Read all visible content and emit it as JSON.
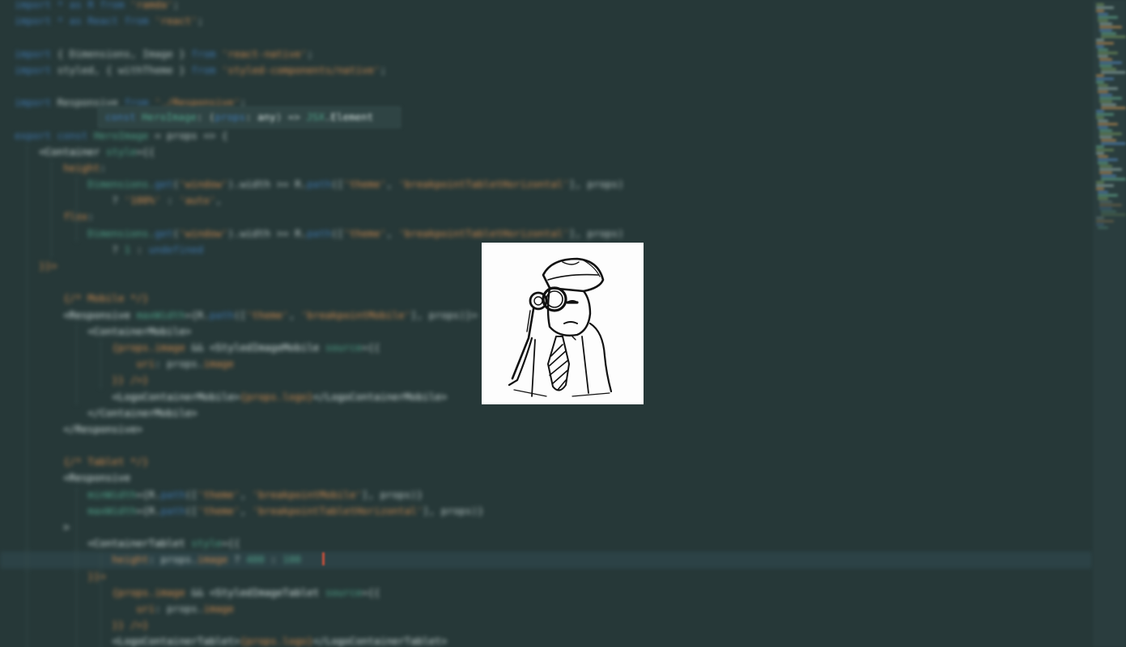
{
  "theme": {
    "background": "#263838",
    "keyword": "#3f78b0",
    "string": "#d18b4f",
    "identifier": "#b9c6c4",
    "type": "#52a58c",
    "bright": "#d6e2e0"
  },
  "editor": {
    "lines": [
      [
        {
          "t": "import ",
          "c": "kw"
        },
        {
          "t": "* as R from ",
          "c": "kw"
        },
        {
          "t": "'ramda'",
          "c": "str"
        },
        {
          "t": ";",
          "c": "pl"
        }
      ],
      [
        {
          "t": "import ",
          "c": "kw"
        },
        {
          "t": "* as React from ",
          "c": "kw"
        },
        {
          "t": "'react'",
          "c": "str"
        },
        {
          "t": ";",
          "c": "pl"
        }
      ],
      [],
      [
        {
          "t": "import ",
          "c": "kw"
        },
        {
          "t": "{ Dimensions, Image } ",
          "c": "id"
        },
        {
          "t": "from ",
          "c": "kw"
        },
        {
          "t": "'react-native'",
          "c": "str"
        },
        {
          "t": ";",
          "c": "pl"
        }
      ],
      [
        {
          "t": "import ",
          "c": "kw"
        },
        {
          "t": "styled, { withTheme } ",
          "c": "id"
        },
        {
          "t": "from ",
          "c": "kw"
        },
        {
          "t": "'styled-components/native'",
          "c": "str"
        },
        {
          "t": ";",
          "c": "pl"
        }
      ],
      [],
      [
        {
          "t": "import ",
          "c": "kw"
        },
        {
          "t": "Responsive ",
          "c": "id"
        },
        {
          "t": "from ",
          "c": "kw"
        },
        {
          "t": "'./Responsive'",
          "c": "str"
        },
        {
          "t": ";",
          "c": "pl"
        }
      ],
      [],
      [
        {
          "t": "export const ",
          "c": "kw"
        },
        {
          "t": "HeroImage",
          "c": "ty"
        },
        {
          "t": " = props => {",
          "c": "id"
        }
      ],
      [
        {
          "t": "    <Container ",
          "c": "br"
        },
        {
          "t": "style",
          "c": "ty"
        },
        {
          "t": "={{",
          "c": "pl"
        }
      ],
      [
        {
          "t": "        height",
          "c": "str"
        },
        {
          "t": ":",
          "c": "pl"
        }
      ],
      [
        {
          "t": "            Dimensions.",
          "c": "ty"
        },
        {
          "t": "get",
          "c": "kw"
        },
        {
          "t": "(",
          "c": "pl"
        },
        {
          "t": "'window'",
          "c": "str"
        },
        {
          "t": ").width >= R.",
          "c": "id"
        },
        {
          "t": "path",
          "c": "kw"
        },
        {
          "t": "([",
          "c": "pl"
        },
        {
          "t": "'theme'",
          "c": "str"
        },
        {
          "t": ", ",
          "c": "pl"
        },
        {
          "t": "'breakpointTabletHorizontal'",
          "c": "str"
        },
        {
          "t": "], props)",
          "c": "id"
        }
      ],
      [
        {
          "t": "                ? ",
          "c": "pl"
        },
        {
          "t": "'100%'",
          "c": "str"
        },
        {
          "t": " : ",
          "c": "pl"
        },
        {
          "t": "'auto'",
          "c": "str"
        },
        {
          "t": ",",
          "c": "pl"
        }
      ],
      [
        {
          "t": "        flex",
          "c": "str"
        },
        {
          "t": ":",
          "c": "pl"
        }
      ],
      [
        {
          "t": "            Dimensions.",
          "c": "ty"
        },
        {
          "t": "get",
          "c": "kw"
        },
        {
          "t": "(",
          "c": "pl"
        },
        {
          "t": "'window'",
          "c": "str"
        },
        {
          "t": ").width >= R.",
          "c": "id"
        },
        {
          "t": "path",
          "c": "kw"
        },
        {
          "t": "([",
          "c": "pl"
        },
        {
          "t": "'theme'",
          "c": "str"
        },
        {
          "t": ", ",
          "c": "pl"
        },
        {
          "t": "'breakpointTabletHorizontal'",
          "c": "str"
        },
        {
          "t": "], props)",
          "c": "id"
        }
      ],
      [
        {
          "t": "                ? ",
          "c": "pl"
        },
        {
          "t": "1",
          "c": "ty"
        },
        {
          "t": " : ",
          "c": "pl"
        },
        {
          "t": "undefined",
          "c": "kw"
        }
      ],
      [
        {
          "t": "    }}>",
          "c": "str"
        }
      ],
      [],
      [
        {
          "t": "        {",
          "c": "str"
        },
        {
          "t": "/* Mobile */",
          "c": "cm"
        },
        {
          "t": "}",
          "c": "str"
        }
      ],
      [
        {
          "t": "        <Responsive ",
          "c": "br"
        },
        {
          "t": "maxWidth",
          "c": "ty"
        },
        {
          "t": "={R.",
          "c": "pl"
        },
        {
          "t": "path",
          "c": "kw"
        },
        {
          "t": "([",
          "c": "pl"
        },
        {
          "t": "'theme'",
          "c": "str"
        },
        {
          "t": ", ",
          "c": "pl"
        },
        {
          "t": "'breakpointMobile'",
          "c": "str"
        },
        {
          "t": "], props)}>",
          "c": "id"
        }
      ],
      [
        {
          "t": "            <ContainerMobile>",
          "c": "br"
        }
      ],
      [
        {
          "t": "                {props.",
          "c": "str"
        },
        {
          "t": "image",
          "c": "str"
        },
        {
          "t": " && ",
          "c": "pl"
        },
        {
          "t": "<StyledImageMobile ",
          "c": "br"
        },
        {
          "t": "source",
          "c": "ty"
        },
        {
          "t": "={{",
          "c": "pl"
        }
      ],
      [
        {
          "t": "                    uri",
          "c": "str"
        },
        {
          "t": ": props.",
          "c": "id"
        },
        {
          "t": "image",
          "c": "str"
        }
      ],
      [
        {
          "t": "                }} />}",
          "c": "str"
        }
      ],
      [
        {
          "t": "                <LogoContainerMobile>",
          "c": "br"
        },
        {
          "t": "{props.",
          "c": "str"
        },
        {
          "t": "logo",
          "c": "str"
        },
        {
          "t": "}",
          "c": "str"
        },
        {
          "t": "</LogoContainerMobile>",
          "c": "br"
        }
      ],
      [
        {
          "t": "            </ContainerMobile>",
          "c": "br"
        }
      ],
      [
        {
          "t": "        </Responsive>",
          "c": "br"
        }
      ],
      [],
      [
        {
          "t": "        {",
          "c": "str"
        },
        {
          "t": "/* Tablet */",
          "c": "cm"
        },
        {
          "t": "}",
          "c": "str"
        }
      ],
      [
        {
          "t": "        <Responsive",
          "c": "br"
        }
      ],
      [
        {
          "t": "            minWidth",
          "c": "ty"
        },
        {
          "t": "={R.",
          "c": "pl"
        },
        {
          "t": "path",
          "c": "kw"
        },
        {
          "t": "([",
          "c": "pl"
        },
        {
          "t": "'theme'",
          "c": "str"
        },
        {
          "t": ", ",
          "c": "pl"
        },
        {
          "t": "'breakpointMobile'",
          "c": "str"
        },
        {
          "t": "], props)}",
          "c": "id"
        }
      ],
      [
        {
          "t": "            maxWidth",
          "c": "ty"
        },
        {
          "t": "={R.",
          "c": "pl"
        },
        {
          "t": "path",
          "c": "kw"
        },
        {
          "t": "([",
          "c": "pl"
        },
        {
          "t": "'theme'",
          "c": "str"
        },
        {
          "t": ", ",
          "c": "pl"
        },
        {
          "t": "'breakpointTabletHorizontal'",
          "c": "str"
        },
        {
          "t": "], props)}",
          "c": "id"
        }
      ],
      [
        {
          "t": "        >",
          "c": "br"
        }
      ],
      [
        {
          "t": "            <ContainerTablet ",
          "c": "br"
        },
        {
          "t": "style",
          "c": "ty"
        },
        {
          "t": "={{",
          "c": "pl"
        }
      ],
      [
        {
          "t": "                height",
          "c": "str"
        },
        {
          "t": ": props.",
          "c": "id"
        },
        {
          "t": "image",
          "c": "str"
        },
        {
          "t": " ? ",
          "c": "pl"
        },
        {
          "t": "400",
          "c": "ty"
        },
        {
          "t": " : ",
          "c": "pl"
        },
        {
          "t": "100",
          "c": "ty"
        }
      ],
      [
        {
          "t": "            }}>",
          "c": "str"
        }
      ],
      [
        {
          "t": "                {props.",
          "c": "str"
        },
        {
          "t": "image",
          "c": "str"
        },
        {
          "t": " && ",
          "c": "pl"
        },
        {
          "t": "<StyledImageTablet ",
          "c": "br"
        },
        {
          "t": "source",
          "c": "ty"
        },
        {
          "t": "={{",
          "c": "pl"
        }
      ],
      [
        {
          "t": "                    uri",
          "c": "str"
        },
        {
          "t": ": props.",
          "c": "id"
        },
        {
          "t": "image",
          "c": "str"
        }
      ],
      [
        {
          "t": "                }} />}",
          "c": "str"
        }
      ],
      [
        {
          "t": "                <LogoContainerTablet>",
          "c": "br"
        },
        {
          "t": "{props.",
          "c": "str"
        },
        {
          "t": "logo",
          "c": "str"
        },
        {
          "t": "}",
          "c": "str"
        },
        {
          "t": "</LogoContainerTablet>",
          "c": "br"
        }
      ]
    ],
    "cursor_line_index": 34,
    "indent_guides": [
      {
        "line_start": 9,
        "line_end": 40,
        "col": 2
      },
      {
        "line_start": 10,
        "line_end": 16,
        "col": 6
      },
      {
        "line_start": 11,
        "line_end": 15,
        "col": 10
      },
      {
        "line_start": 20,
        "line_end": 25,
        "col": 10
      },
      {
        "line_start": 21,
        "line_end": 24,
        "col": 14
      },
      {
        "line_start": 30,
        "line_end": 40,
        "col": 10
      },
      {
        "line_start": 34,
        "line_end": 40,
        "col": 14
      }
    ]
  },
  "tooltip": {
    "segments": [
      {
        "t": "const ",
        "c": "kw"
      },
      {
        "t": "HeroImage",
        "c": "ty"
      },
      {
        "t": ": (",
        "c": "pl"
      },
      {
        "t": "props",
        "c": "kw"
      },
      {
        "t": ": ",
        "c": "pl"
      },
      {
        "t": "any",
        "c": "br"
      },
      {
        "t": ") => ",
        "c": "pl"
      },
      {
        "t": "JSX",
        "c": "ty"
      },
      {
        "t": ".",
        "c": "pl"
      },
      {
        "t": "Element",
        "c": "br"
      }
    ]
  },
  "minimap_colors": [
    "#6d8c5a",
    "#4f7fb0",
    "#8aa3a0",
    "#5e9e86",
    "#b0864f"
  ],
  "overlay": {
    "icon": "detective-with-magnifier-icon"
  }
}
